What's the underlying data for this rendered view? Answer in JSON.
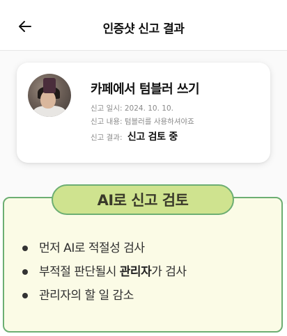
{
  "header": {
    "title": "인증샷 신고 결과",
    "back_icon": "arrow-left-icon"
  },
  "report": {
    "title": "카페에서 텀블러 쓰기",
    "date_label": "신고 일시:",
    "date_value": "2024. 10. 10.",
    "content_label": "신고 내용:",
    "content_value": "텀블러를 사용하셔야죠",
    "result_label": "신고 결과:",
    "result_value": "신고 검토 중"
  },
  "callout": {
    "heading": "AI로 신고 검토",
    "bullet1": "먼저 AI로 적절성 검사",
    "bullet2_pre": "부적절 판단될시 ",
    "bullet2_bold": "관리자",
    "bullet2_post": "가 검사",
    "bullet3": "관리자의 할 일 감소",
    "colors": {
      "border": "#6cae72",
      "pill": "#cfe38f",
      "background": "#fbfbe6"
    }
  }
}
